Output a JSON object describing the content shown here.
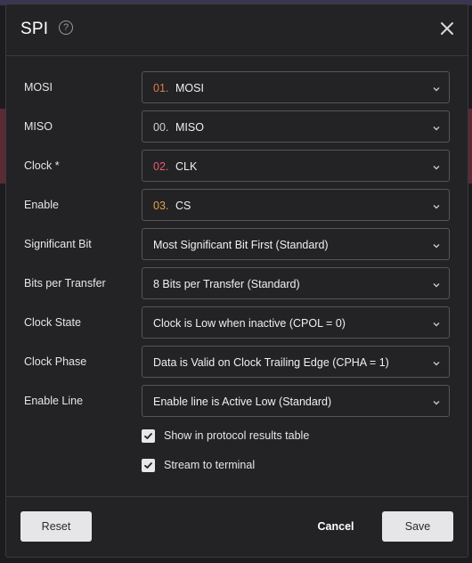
{
  "dialog": {
    "title": "SPI",
    "help_icon": "question-circle-icon",
    "close_icon": "close-icon"
  },
  "fields": {
    "mosi": {
      "label": "MOSI",
      "channel": "01.",
      "value": "MOSI",
      "channel_color": "#e07a4a"
    },
    "miso": {
      "label": "MISO",
      "channel": "00.",
      "value": "MISO",
      "channel_color": "#d0d0d4"
    },
    "clock": {
      "label": "Clock *",
      "channel": "02.",
      "value": "CLK",
      "channel_color": "#e85a6a"
    },
    "enable": {
      "label": "Enable",
      "channel": "03.",
      "value": "CS",
      "channel_color": "#e8a040"
    },
    "significant_bit": {
      "label": "Significant Bit",
      "value": "Most Significant Bit First (Standard)"
    },
    "bits_per_transfer": {
      "label": "Bits per Transfer",
      "value": "8 Bits per Transfer (Standard)"
    },
    "clock_state": {
      "label": "Clock State",
      "value": "Clock is Low when inactive (CPOL = 0)"
    },
    "clock_phase": {
      "label": "Clock Phase",
      "value": "Data is Valid on Clock Trailing Edge (CPHA = 1)"
    },
    "enable_line": {
      "label": "Enable Line",
      "value": "Enable line is Active Low (Standard)"
    }
  },
  "options": {
    "show_in_table": {
      "label": "Show in protocol results table",
      "checked": true
    },
    "stream_to_terminal": {
      "label": "Stream to terminal",
      "checked": true
    }
  },
  "footer": {
    "reset_label": "Reset",
    "cancel_label": "Cancel",
    "save_label": "Save"
  },
  "colors": {
    "dialog_bg": "#232326",
    "border": "#55555a",
    "button_bg": "#e6e6e8"
  }
}
